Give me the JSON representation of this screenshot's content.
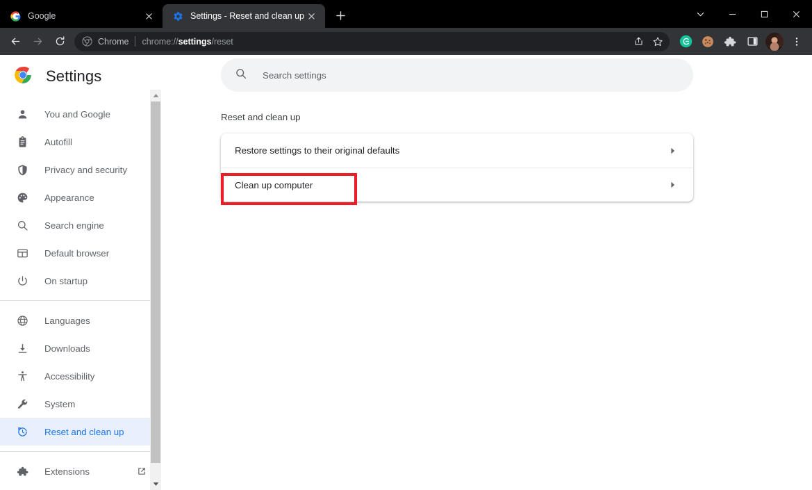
{
  "window": {
    "controls": [
      {
        "name": "tab-search",
        "glyph": "chevron-down-icon"
      },
      {
        "name": "minimize",
        "glyph": "minimize-icon"
      },
      {
        "name": "maximize",
        "glyph": "maximize-icon"
      },
      {
        "name": "close",
        "glyph": "close-icon"
      }
    ]
  },
  "tabs": [
    {
      "title": "Google",
      "favicon": "google-g-icon",
      "active": false
    },
    {
      "title": "Settings - Reset and clean up",
      "favicon": "settings-gear-icon",
      "active": true
    }
  ],
  "newtab_label": "+",
  "toolbar": {
    "back_icon": "back-arrow-icon",
    "forward_icon": "forward-arrow-icon",
    "reload_icon": "reload-icon",
    "omnibox": {
      "chip_icon": "chrome-logo-icon",
      "chip_label": "Chrome",
      "url_prefix": "chrome://",
      "url_host": "settings",
      "url_path": "/reset",
      "share_icon": "share-icon",
      "bookmark_icon": "star-icon"
    },
    "extensions": [
      {
        "name": "grammarly-extension-icon",
        "label": "G"
      },
      {
        "name": "cookie-extension-icon",
        "label": ""
      },
      {
        "name": "extensions-puzzle-icon",
        "label": ""
      },
      {
        "name": "side-panel-icon",
        "label": ""
      }
    ],
    "profile_name": "profile-avatar",
    "menu_icon": "three-dot-menu-icon"
  },
  "sidebar": {
    "brand_title": "Settings",
    "brand_icon": "chrome-logo-icon",
    "groups": [
      {
        "items": [
          {
            "label": "You and Google",
            "icon": "person-icon",
            "selected": false
          },
          {
            "label": "Autofill",
            "icon": "clipboard-icon",
            "selected": false
          },
          {
            "label": "Privacy and security",
            "icon": "shield-icon",
            "selected": false
          },
          {
            "label": "Appearance",
            "icon": "palette-icon",
            "selected": false
          },
          {
            "label": "Search engine",
            "icon": "search-icon",
            "selected": false
          },
          {
            "label": "Default browser",
            "icon": "browser-window-icon",
            "selected": false
          },
          {
            "label": "On startup",
            "icon": "power-icon",
            "selected": false
          }
        ]
      },
      {
        "items": [
          {
            "label": "Languages",
            "icon": "globe-icon",
            "selected": false
          },
          {
            "label": "Downloads",
            "icon": "download-icon",
            "selected": false
          },
          {
            "label": "Accessibility",
            "icon": "accessibility-icon",
            "selected": false
          },
          {
            "label": "System",
            "icon": "wrench-icon",
            "selected": false
          },
          {
            "label": "Reset and clean up",
            "icon": "restore-history-icon",
            "selected": true
          }
        ]
      },
      {
        "items": [
          {
            "label": "Extensions",
            "icon": "puzzle-icon",
            "selected": false,
            "external": true
          }
        ]
      }
    ],
    "scrollbar": {
      "up_icon": "scroll-up-arrow-icon",
      "down_icon": "scroll-down-arrow-icon"
    }
  },
  "main": {
    "search": {
      "placeholder": "Search settings",
      "value": "",
      "icon": "search-icon"
    },
    "section_title": "Reset and clean up",
    "rows": [
      {
        "label": "Restore settings to their original defaults",
        "arrow": "chevron-right-icon"
      },
      {
        "label": "Clean up computer",
        "arrow": "chevron-right-icon"
      }
    ]
  },
  "annotation": {
    "highlight_color": "#ee1d23",
    "target": "Clean up computer"
  },
  "colors": {
    "accent": "#1a73e8",
    "selected_bg": "#e8f0fe",
    "toolbar_bg": "#333438",
    "tabstrip_bg": "#000000",
    "search_bg": "#f1f3f4"
  }
}
